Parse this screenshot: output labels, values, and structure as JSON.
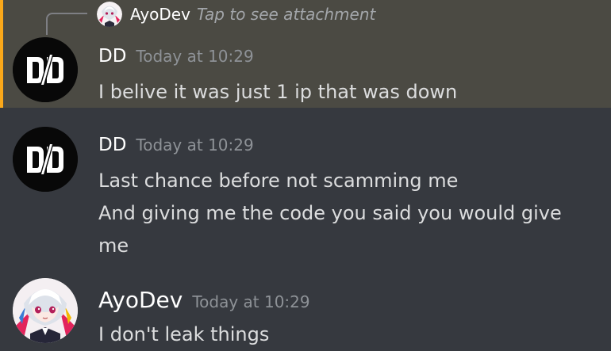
{
  "theme": {
    "background": "#36393f",
    "highlight_background": "#4b4a43",
    "highlight_accent": "#faa81a",
    "username_color": "#ffffff",
    "timestamp_color": "#8e9297",
    "text_color": "#dcddde"
  },
  "reply": {
    "username": "AyoDev",
    "text": "Tap to see attachment"
  },
  "messages": [
    {
      "username": "DD",
      "timestamp": "Today at 10:29",
      "avatar_icon": "dd-logo-avatar",
      "lines": [
        "I belive it was just 1 ip that was down"
      ]
    },
    {
      "username": "DD",
      "timestamp": "Today at 10:29",
      "avatar_icon": "dd-logo-avatar",
      "lines": [
        "Last chance before not scamming me",
        "And giving me the code you said you would give",
        "me"
      ]
    },
    {
      "username": "AyoDev",
      "timestamp": "Today at 10:29",
      "avatar_icon": "anime-character-avatar",
      "lines": [
        "I don't leak things"
      ]
    }
  ]
}
